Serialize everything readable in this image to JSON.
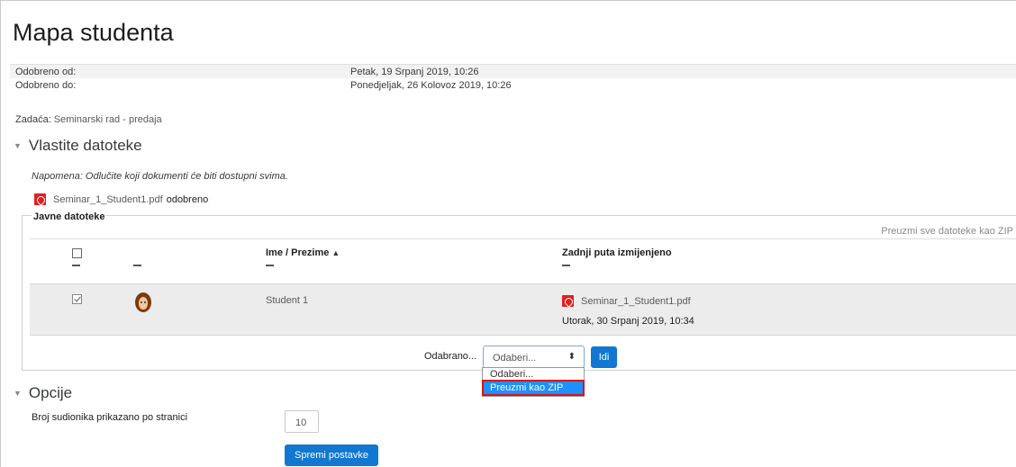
{
  "page": {
    "title": "Mapa studenta"
  },
  "dates": {
    "from_label": "Odobreno od:",
    "from_value": "Petak, 19 Srpanj 2019, 10:26",
    "to_label": "Odobreno do:",
    "to_value": "Ponedjeljak, 26 Kolovoz 2019, 10:26"
  },
  "assignment": {
    "label": "Zadaća:",
    "value": "Seminarski rad - predaja"
  },
  "own_files": {
    "heading": "Vlastite datoteke",
    "note": "Napomena: Odlučite koji dokumenti će biti dostupni svima.",
    "file_name": "Seminar_1_Student1.pdf",
    "file_status": "odobreno"
  },
  "public_files": {
    "legend": "Javne datoteke",
    "zip_link": "Preuzmi sve datoteke kao ZIP",
    "columns": {
      "name_first": "Ime",
      "separator": "/",
      "name_last": "Prezime",
      "sort_indicator": "▲",
      "modified": "Zadnji puta izmijenjeno"
    },
    "rows": [
      {
        "checked": true,
        "name": "Student 1",
        "file": "Seminar_1_Student1.pdf",
        "modified": "Utorak, 30 Srpanj 2019, 10:34"
      }
    ],
    "bulk": {
      "label": "Odabrano...",
      "select_value": "Odaberi...",
      "select_arrows": "⬍",
      "go_button": "Idi",
      "options": [
        "Odaberi...",
        "Preuzmi kao ZIP"
      ]
    }
  },
  "options": {
    "heading": "Opcije",
    "per_page_label": "Broj sudionika prikazano po stranici",
    "per_page_value": "10",
    "save_button": "Spremi postavke"
  },
  "colors": {
    "primary_button": "#1177d1",
    "pdf_icon": "#e02020",
    "dropdown_highlight": "#1e90ff"
  }
}
